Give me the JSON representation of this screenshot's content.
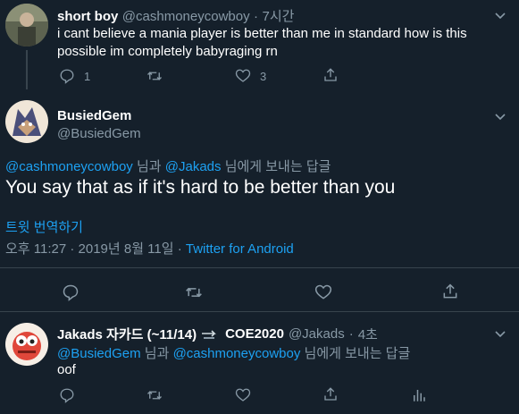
{
  "tweet1": {
    "name": "short boy",
    "handle": "@cashmoneycowboy",
    "time": "7시간",
    "text_line1": "i cant believe a mania player is better than me in standard how is this",
    "text_line2": "possible im completely babyraging rn",
    "reply_count": "1",
    "like_count": "3"
  },
  "tweet2": {
    "name": "BusiedGem",
    "handle": "@BusiedGem",
    "reply_to_user1": "@cashmoneycowboy",
    "reply_and": "님과",
    "reply_to_user2": "@Jakads",
    "reply_suffix": "님에게 보내는 답글",
    "text": "You say that as if it's hard to be better than you",
    "translate": "트윗 번역하기",
    "timestamp": "오후 11:27 · 2019년 8월 11일 ·",
    "source": "Twitter for Android"
  },
  "tweet3": {
    "name": "Jakads 자카드 (~11/14)",
    "name_suffix": "COE2020",
    "handle": "@Jakads",
    "time": "4초",
    "reply_to_user1": "@BusiedGem",
    "reply_and": "님과",
    "reply_to_user2": "@cashmoneycowboy",
    "reply_suffix": "님에게 보내는 답글",
    "text": "oof"
  },
  "colors": {
    "background": "#15202b",
    "link": "#1da1f2",
    "muted": "#8899a6",
    "divider": "#38444d"
  }
}
